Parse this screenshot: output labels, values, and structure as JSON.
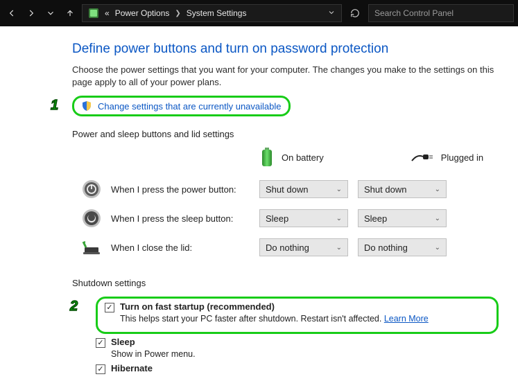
{
  "titlebar": {
    "breadcrumb_prefix": "«",
    "crumb1": "Power Options",
    "crumb2": "System Settings",
    "search_placeholder": "Search Control Panel"
  },
  "page": {
    "heading": "Define power buttons and turn on password protection",
    "description": "Choose the power settings that you want for your computer. The changes you make to the settings on this page apply to all of your power plans.",
    "change_link": "Change settings that are currently unavailable",
    "section_buttons_title": "Power and sleep buttons and lid settings",
    "col_battery": "On battery",
    "col_plugged": "Plugged in",
    "rows": {
      "power": {
        "label": "When I press the power button:",
        "battery": "Shut down",
        "plugged": "Shut down"
      },
      "sleep": {
        "label": "When I press the sleep button:",
        "battery": "Sleep",
        "plugged": "Sleep"
      },
      "lid": {
        "label": "When I close the lid:",
        "battery": "Do nothing",
        "plugged": "Do nothing"
      }
    },
    "section_shutdown_title": "Shutdown settings",
    "fast_startup": {
      "title": "Turn on fast startup (recommended)",
      "desc": "This helps start your PC faster after shutdown. Restart isn't affected. ",
      "learn_more": "Learn More"
    },
    "sleep_opt": {
      "title": "Sleep",
      "desc": "Show in Power menu."
    },
    "hibernate_opt": {
      "title": "Hibernate"
    }
  },
  "annotations": {
    "num1": "1",
    "num2": "2"
  }
}
